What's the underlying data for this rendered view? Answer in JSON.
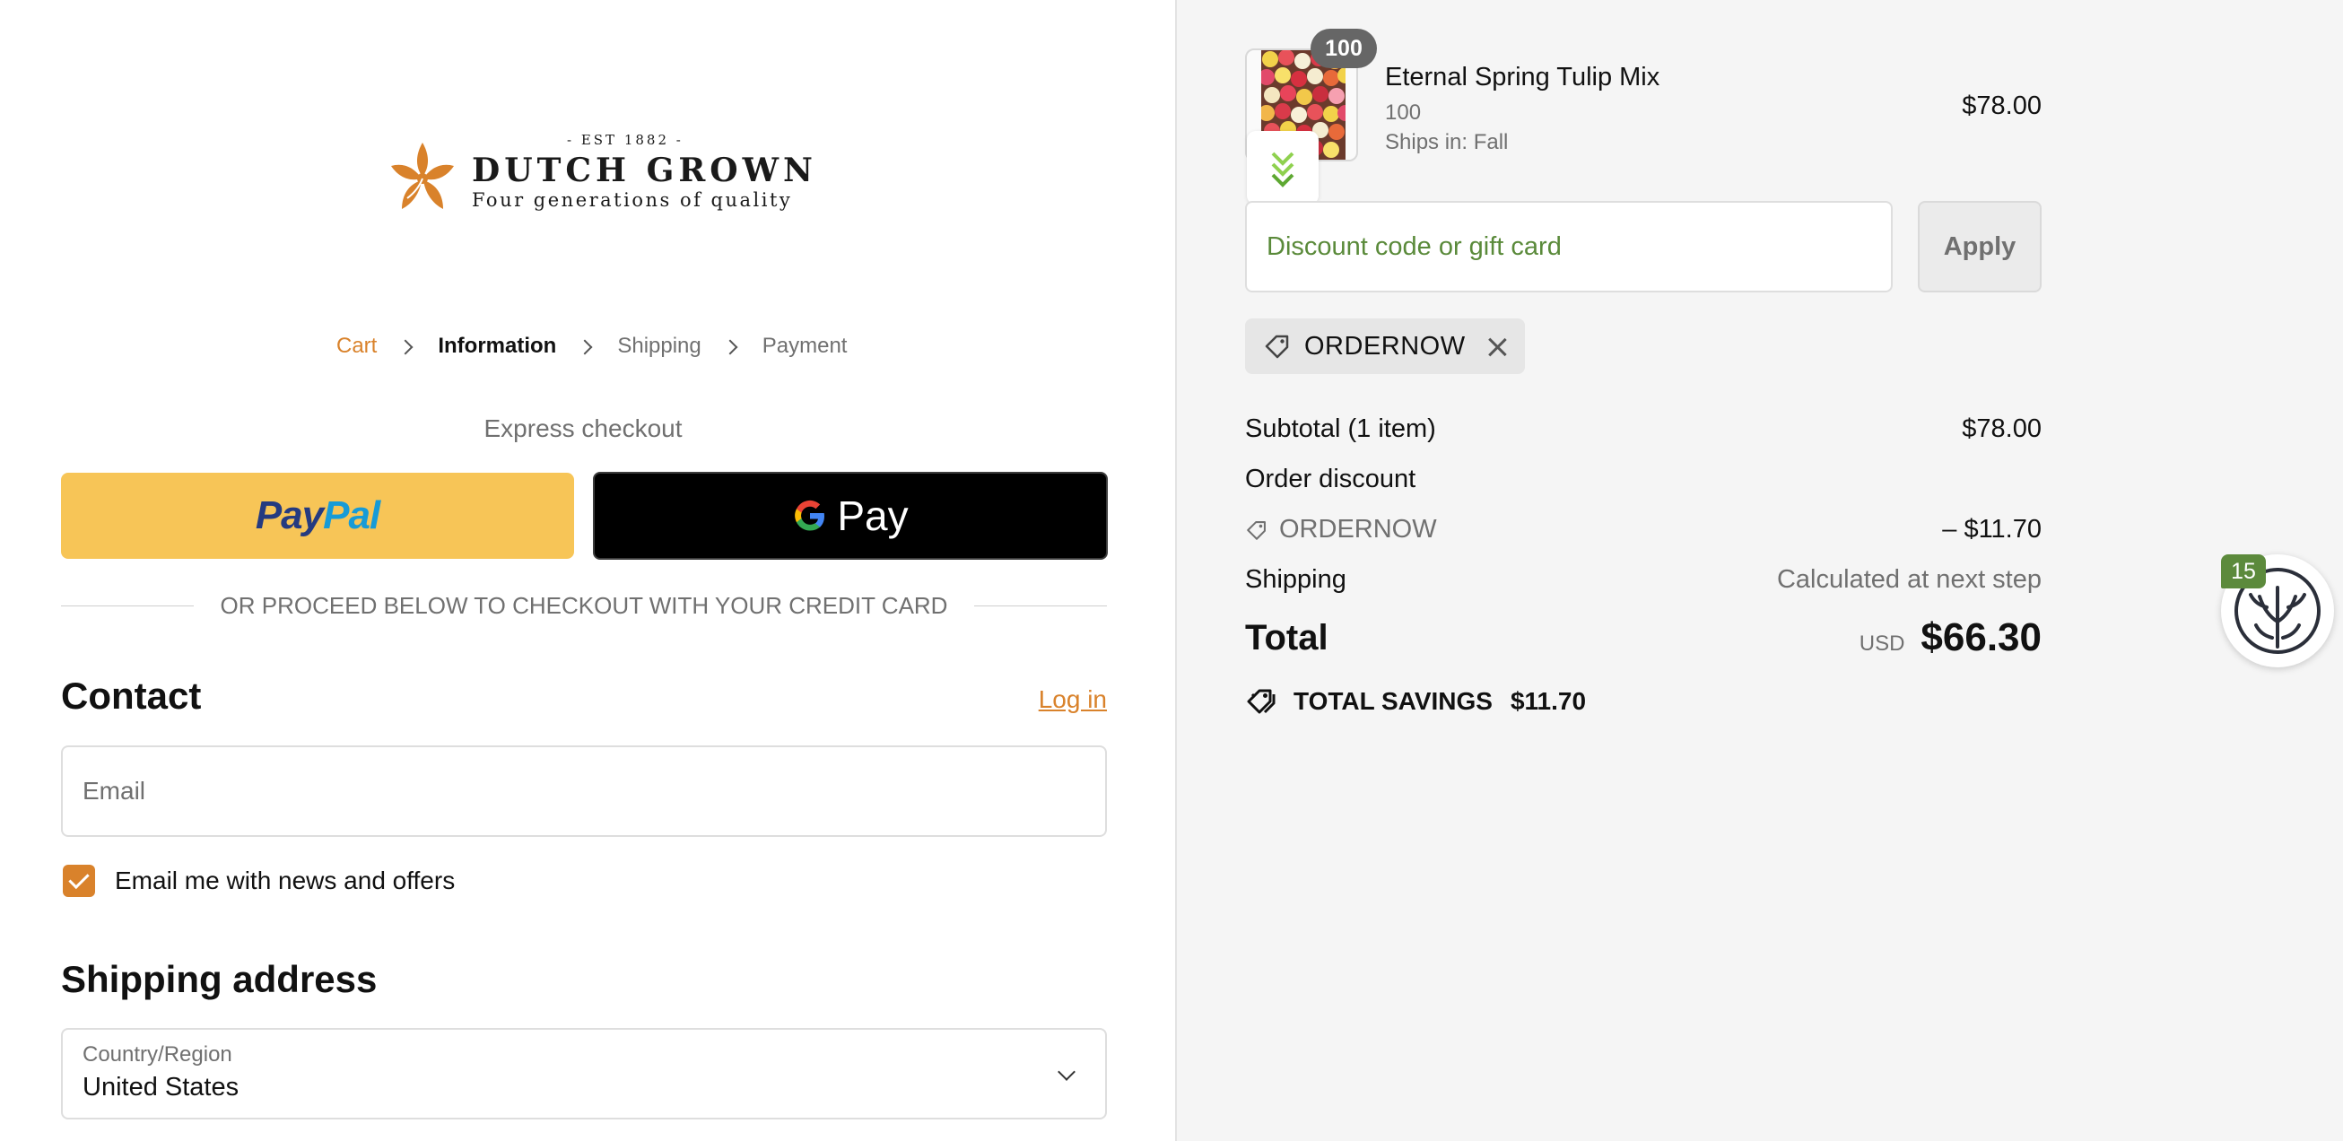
{
  "brand": {
    "est": "- EST 1882 -",
    "name": "DUTCH GROWN",
    "tagline": "Four generations of quality",
    "accent_color": "#d9822b"
  },
  "breadcrumb": {
    "items": [
      {
        "label": "Cart",
        "state": "link"
      },
      {
        "label": "Information",
        "state": "current"
      },
      {
        "label": "Shipping",
        "state": "upcoming"
      },
      {
        "label": "Payment",
        "state": "upcoming"
      }
    ]
  },
  "express": {
    "title": "Express checkout",
    "paypal_a": "Pay",
    "paypal_b": "Pal",
    "gpay_label": "Pay",
    "divider": "OR PROCEED BELOW TO CHECKOUT WITH YOUR CREDIT CARD"
  },
  "contact": {
    "title": "Contact",
    "login": "Log in",
    "email_placeholder": "Email",
    "newsletter_label": "Email me with news and offers",
    "newsletter_checked": true
  },
  "shipping_address": {
    "title": "Shipping address",
    "country_label": "Country/Region",
    "country_value": "United States"
  },
  "cart": {
    "item": {
      "quantity_badge": "100",
      "name": "Eternal Spring Tulip Mix",
      "variant": "100",
      "ships": "Ships in: Fall",
      "price": "$78.00"
    },
    "discount_placeholder": "Discount code or gift card",
    "apply_label": "Apply",
    "applied_code": "ORDERNOW"
  },
  "summary": {
    "subtotal_label": "Subtotal (1 item)",
    "subtotal_value": "$78.00",
    "order_discount_label": "Order discount",
    "discount_code": "ORDERNOW",
    "discount_value": "– $11.70",
    "shipping_label": "Shipping",
    "shipping_value": "Calculated at next step",
    "total_label": "Total",
    "currency": "USD",
    "total_value": "$66.30",
    "savings_label": "TOTAL SAVINGS",
    "savings_value": "$11.70"
  },
  "tree_widget": {
    "badge": "15"
  }
}
